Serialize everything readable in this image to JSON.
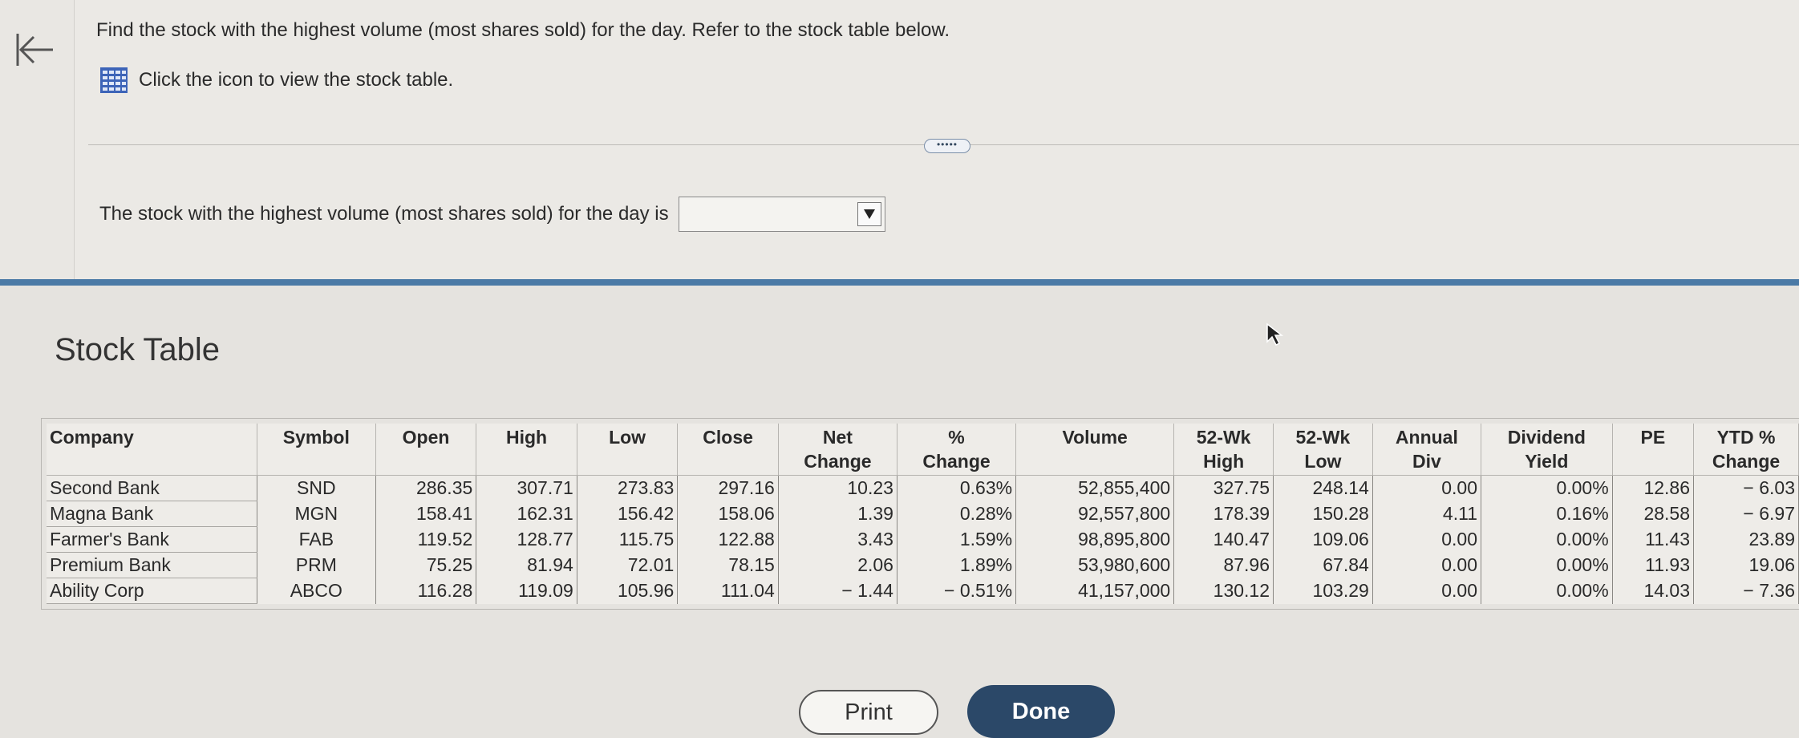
{
  "question": {
    "prompt": "Find the stock with the highest volume (most shares sold) for the day. Refer to the stock table below.",
    "table_link": "Click the icon to view the stock table.",
    "more_label": "•••••",
    "answer_label": "The stock with the highest volume (most shares sold) for the day is",
    "answer_value": ""
  },
  "modal": {
    "title": "Stock Table",
    "print_label": "Print",
    "done_label": "Done"
  },
  "table": {
    "headers": [
      [
        "Company"
      ],
      [
        "Symbol"
      ],
      [
        "Open"
      ],
      [
        "High"
      ],
      [
        "Low"
      ],
      [
        "Close"
      ],
      [
        "Net",
        "Change"
      ],
      [
        "%",
        "Change"
      ],
      [
        "Volume"
      ],
      [
        "52-Wk",
        "High"
      ],
      [
        "52-Wk",
        "Low"
      ],
      [
        "Annual",
        "Div"
      ],
      [
        "Dividend",
        "Yield"
      ],
      [
        "PE"
      ],
      [
        "YTD %",
        "Change"
      ]
    ],
    "rows": [
      [
        "Second Bank",
        "SND",
        "286.35",
        "307.71",
        "273.83",
        "297.16",
        "10.23",
        "0.63%",
        "52,855,400",
        "327.75",
        "248.14",
        "0.00",
        "0.00%",
        "12.86",
        "− 6.03"
      ],
      [
        "Magna Bank",
        "MGN",
        "158.41",
        "162.31",
        "156.42",
        "158.06",
        "1.39",
        "0.28%",
        "92,557,800",
        "178.39",
        "150.28",
        "4.11",
        "0.16%",
        "28.58",
        "− 6.97"
      ],
      [
        "Farmer's Bank",
        "FAB",
        "119.52",
        "128.77",
        "115.75",
        "122.88",
        "3.43",
        "1.59%",
        "98,895,800",
        "140.47",
        "109.06",
        "0.00",
        "0.00%",
        "11.43",
        "23.89"
      ],
      [
        "Premium Bank",
        "PRM",
        "75.25",
        "81.94",
        "72.01",
        "78.15",
        "2.06",
        "1.89%",
        "53,980,600",
        "87.96",
        "67.84",
        "0.00",
        "0.00%",
        "11.93",
        "19.06"
      ],
      [
        "Ability Corp",
        "ABCO",
        "116.28",
        "119.09",
        "105.96",
        "111.04",
        "− 1.44",
        "− 0.51%",
        "41,157,000",
        "130.12",
        "103.29",
        "0.00",
        "0.00%",
        "14.03",
        "− 7.36"
      ]
    ]
  },
  "icons": {
    "back": "back-arrow-icon",
    "table": "table-grid-icon",
    "dropdown": "dropdown-arrow-icon"
  },
  "colors": {
    "accent": "#2b4868",
    "band": "#4b7aa6",
    "icon_blue": "#3d64b8"
  }
}
